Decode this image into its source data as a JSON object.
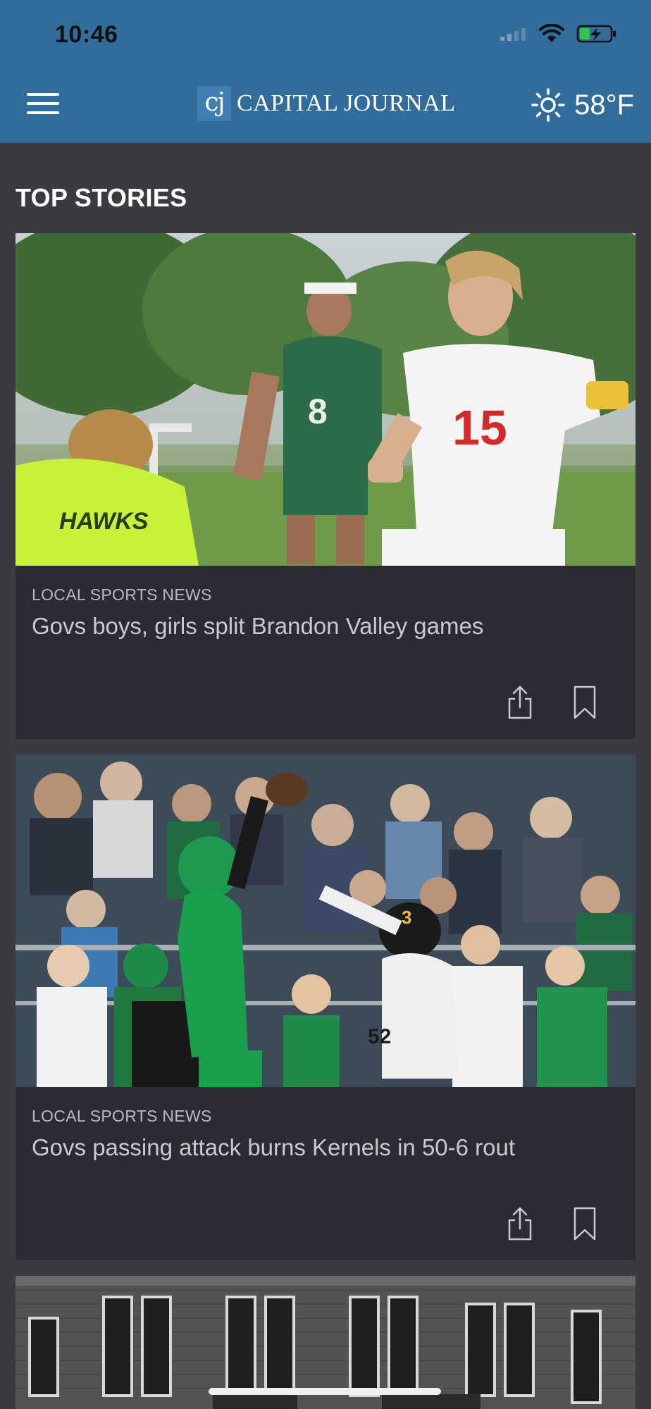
{
  "status_bar": {
    "time": "10:46"
  },
  "header": {
    "brand_mark": "cj",
    "brand_name": "CAPITAL JOURNAL",
    "temperature": "58°F",
    "weather_icon": "sun-icon"
  },
  "section": {
    "title": "TOP STORIES"
  },
  "stories": [
    {
      "category": "LOCAL SPORTS NEWS",
      "headline": "Govs boys, girls split Brandon Valley games",
      "image": "girls-soccer-photo"
    },
    {
      "category": "LOCAL SPORTS NEWS",
      "headline": "Govs passing attack burns Kernels in 50-6 rout",
      "image": "football-catch-photo"
    },
    {
      "image": "historic-brick-building-photo"
    }
  ],
  "colors": {
    "header_bg": "#316c9b",
    "page_bg": "#3a3b41",
    "card_bg": "#2b2c33"
  }
}
